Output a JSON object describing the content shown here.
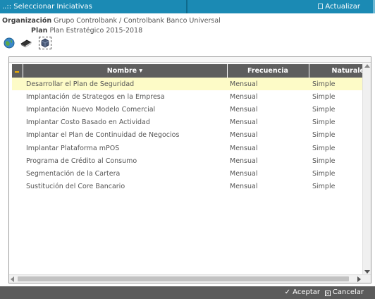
{
  "window": {
    "title": "..:: Seleccionar Iniciativas",
    "refresh_label": "Actualizar"
  },
  "context": {
    "org_label": "Organización",
    "org_value": "Grupo Controlbank / Controlbank Banco Universal",
    "plan_label": "Plan",
    "plan_value": "Plan Estratégico 2015-2018"
  },
  "toolbar": {
    "icons": [
      "globe-icon",
      "book-icon",
      "cube-icon"
    ]
  },
  "grid": {
    "columns": {
      "name": "Nombre ▾",
      "frequency": "Frecuencia",
      "nature": "Naturaleza"
    },
    "rows": [
      {
        "name": "Desarrollar el Plan de Seguridad",
        "frequency": "Mensual",
        "nature": "Simple"
      },
      {
        "name": "Implantación de Strategos en la Empresa",
        "frequency": "Mensual",
        "nature": "Simple"
      },
      {
        "name": "Implantación Nuevo Modelo Comercial",
        "frequency": "Mensual",
        "nature": "Simple"
      },
      {
        "name": "Implantar Costo Basado en Actividad",
        "frequency": "Mensual",
        "nature": "Simple"
      },
      {
        "name": "Implantar el Plan de Continuidad de Negocios",
        "frequency": "Mensual",
        "nature": "Simple"
      },
      {
        "name": "Implantar Plataforma mPOS",
        "frequency": "Mensual",
        "nature": "Simple"
      },
      {
        "name": "Programa de Crédito al Consumo",
        "frequency": "Mensual",
        "nature": "Simple"
      },
      {
        "name": "Segmentación de la Cartera",
        "frequency": "Mensual",
        "nature": "Simple"
      },
      {
        "name": "Sustitución del Core Bancario",
        "frequency": "Mensual",
        "nature": "Simple"
      }
    ],
    "selected_index": 0
  },
  "footer": {
    "accept_label": "Aceptar",
    "cancel_label": "Cancelar"
  },
  "colors": {
    "titlebar": "#1b8ab4",
    "header": "#5e5e5e",
    "selected_row": "#fdfbc7",
    "footer": "#5b5b5b"
  }
}
